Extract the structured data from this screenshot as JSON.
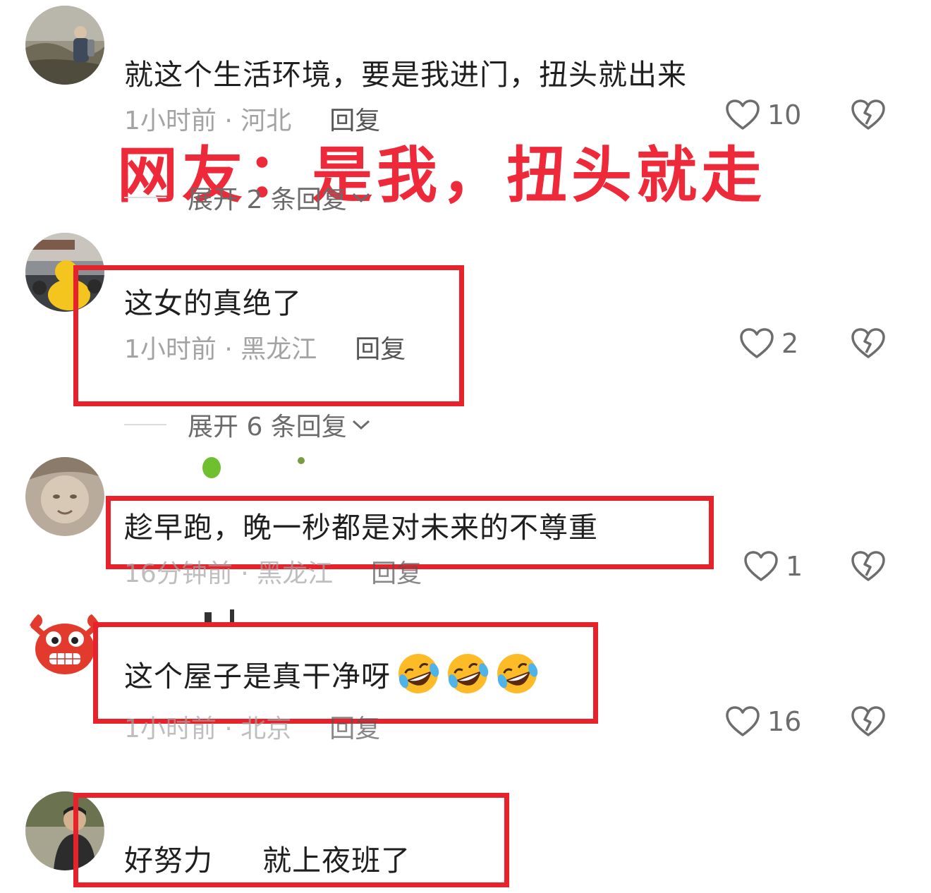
{
  "overlay_caption": "网友：是我，扭头就走",
  "comments": [
    {
      "text": "就这个生活环境，要是我进门，扭头就出来",
      "time": "1小时前",
      "location": "河北",
      "reply_label": "回复",
      "likes": "10",
      "expand_label": "展开 2 条回复",
      "avatar_icon": "avatar-photo-hiker-icon"
    },
    {
      "text": "这女的真绝了",
      "time": "1小时前",
      "location": "黑龙江",
      "reply_label": "回复",
      "likes": "2",
      "expand_label": "展开 6 条回复",
      "avatar_icon": "avatar-photo-duck-icon"
    },
    {
      "text": "趁早跑，晚一秒都是对未来的不尊重",
      "time": "16分钟前",
      "location": "黑龙江",
      "reply_label": "回复",
      "likes": "1",
      "avatar_icon": "avatar-photo-baby-icon"
    },
    {
      "text": "这个屋子是真干净呀",
      "emoji": [
        "rolling-laughing-emoji",
        "rolling-laughing-emoji",
        "rolling-laughing-emoji"
      ],
      "time": "1小时前",
      "location": "北京",
      "reply_label": "回复",
      "likes": "16",
      "avatar_icon": "avatar-crab-cartoon-icon"
    },
    {
      "text": "好努力     就上夜班了",
      "avatar_icon": "avatar-photo-man-icon"
    }
  ],
  "colors": {
    "highlight_red": "#e8222b",
    "overlay_red": "#ee2a3a",
    "meta_gray": "#a3a3a3",
    "icon_gray": "#6d6d6d"
  },
  "icons": {
    "like": "heart-outline-icon",
    "dislike": "broken-heart-icon",
    "expand": "chevron-down-icon"
  }
}
